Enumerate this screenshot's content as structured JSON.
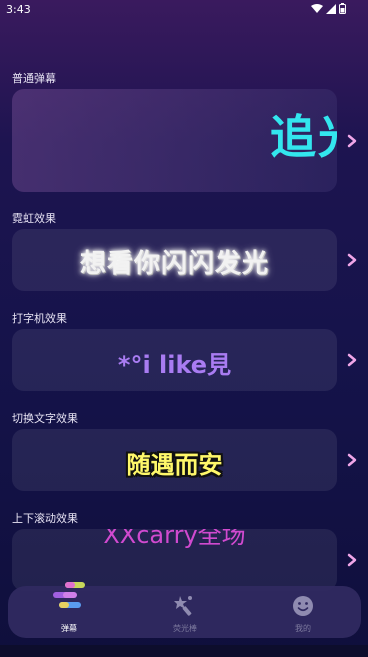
{
  "status_bar": {
    "time": "3:43"
  },
  "sections": [
    {
      "label": "普通弹幕",
      "sample": "追光"
    },
    {
      "label": "霓虹效果",
      "sample": "想看你闪闪发光"
    },
    {
      "label": "打字机效果",
      "sample": "*°i like見"
    },
    {
      "label": "切换文字效果",
      "sample": "随遇而安"
    },
    {
      "label": "上下滚动效果",
      "sample": "XXcarry全场"
    }
  ],
  "tabs": [
    {
      "label": "弹幕",
      "icon": "danmaku-icon",
      "active": true
    },
    {
      "label": "荧光棒",
      "icon": "glowstick-icon",
      "active": false
    },
    {
      "label": "我的",
      "icon": "smiley-icon",
      "active": false
    }
  ],
  "colors": {
    "accent_cyan": "#33e6ee",
    "typewriter_purple": "#a97cf2",
    "switch_yellow": "#fff86a",
    "scroll_magenta": "#d14ad0",
    "chevron_pink": "#f0a6e8"
  }
}
